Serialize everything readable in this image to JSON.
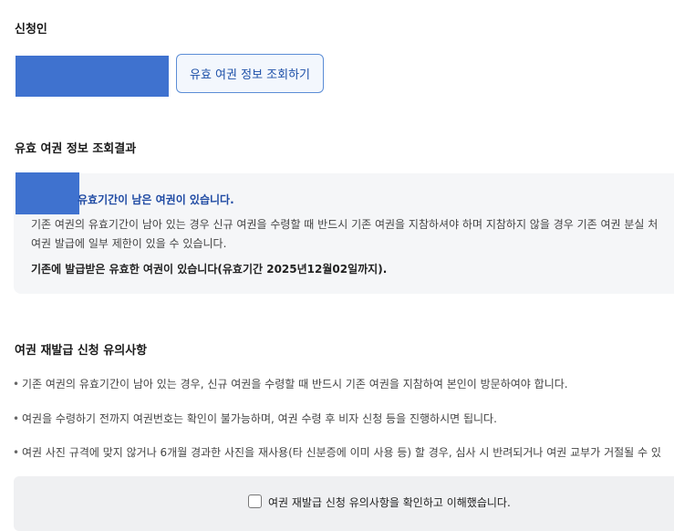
{
  "applicant": {
    "heading": "신청인",
    "lookup_button": "유효 여권 정보 조회하기"
  },
  "result": {
    "heading": "유효 여권 정보 조회결과",
    "status": "유효기간이 남은 여권이 있습니다.",
    "description_line1": "기존 여권의 유효기간이 남아 있는 경우 신규 여권을 수령할 때 반드시 기존 여권을 지참하셔야 하며 지참하지 않을 경우 기존 여권 분실 처",
    "description_line2": "여권 발급에 일부 제한이 있을 수 있습니다.",
    "strong": "기존에 발급받은 유효한 여권이 있습니다(유효기간 2025년12월02일까지)."
  },
  "notices": {
    "heading": "여권 재발급 신청 유의사항",
    "items": [
      "기존 여권의 유효기간이 남아 있는 경우, 신규 여권을 수령할 때 반드시 기존 여권을 지참하여 본인이 방문하여야 합니다.",
      "여권을 수령하기 전까지 여권번호는 확인이 불가능하며, 여권 수령 후 비자 신청 등을 진행하시면 됩니다.",
      "여권 사진 규격에 맞지 않거나 6개월 경과한 사진을 재사용(타 신분증에 이미 사용 등) 할 경우, 심사 시 반려되거나 여권 교부가 거절될 수 있"
    ],
    "bullet": "•"
  },
  "confirm": {
    "label": "여권 재발급 신청 유의사항을 확인하고 이해했습니다.",
    "checked": false
  },
  "colors": {
    "accent": "#1f4aa3",
    "redaction": "#3f72cf",
    "panel": "#f5f6f8"
  }
}
